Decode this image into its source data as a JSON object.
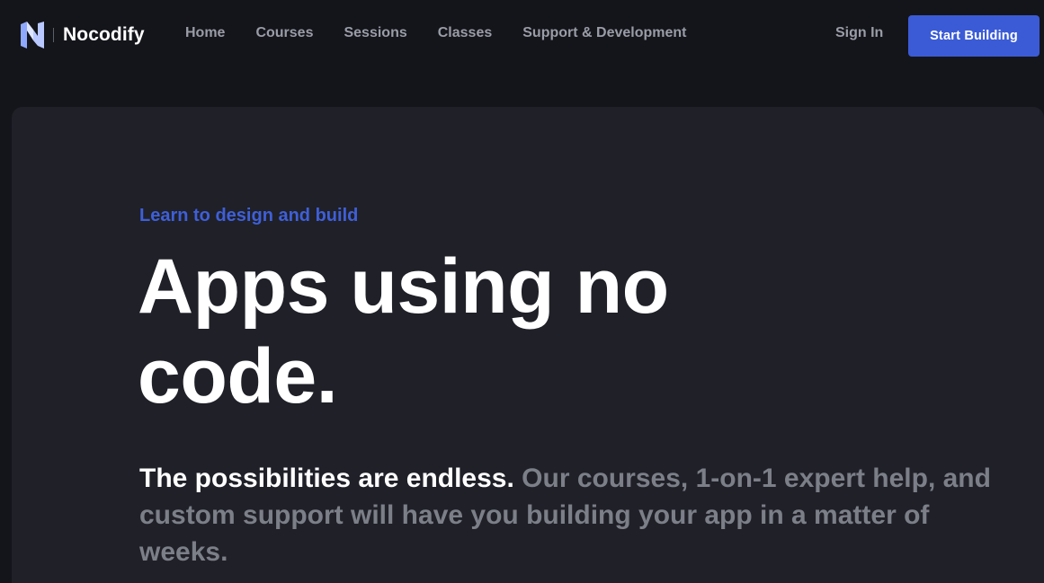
{
  "header": {
    "brand": "Nocodify",
    "logo_icon": "nocodify-n-logo-icon",
    "nav": [
      {
        "label": "Home"
      },
      {
        "label": "Courses"
      },
      {
        "label": "Sessions"
      },
      {
        "label": "Classes"
      },
      {
        "label": "Support & Development"
      }
    ],
    "sign_in": "Sign In",
    "cta": "Start Building"
  },
  "hero": {
    "eyebrow": "Learn to design and build",
    "headline": "Apps using no code.",
    "lead_strong": "The possibilities are endless.",
    "lead_rest": " Our courses, 1-on-1 expert help, and custom support will have you building your app in a matter of weeks."
  },
  "colors": {
    "background": "#14151b",
    "card": "#1f2028",
    "accent": "#3b5bd6",
    "nav_text": "#9a9ca6",
    "muted_text": "#7c7e88"
  }
}
